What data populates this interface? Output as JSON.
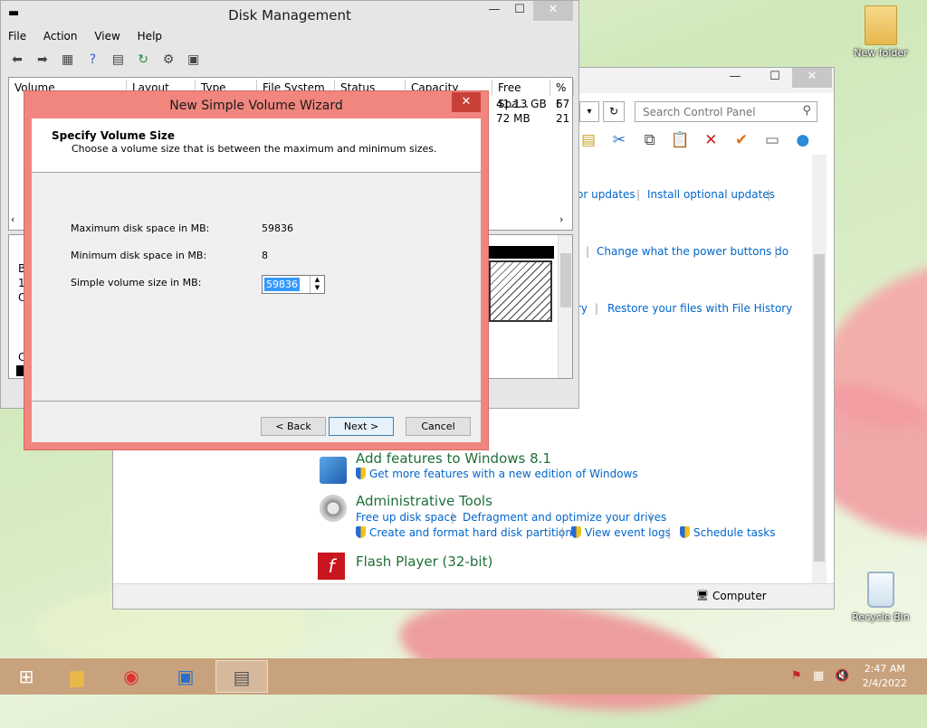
{
  "desktop": {
    "icons": [
      {
        "label": "New folder"
      },
      {
        "label": "Recycle Bin"
      }
    ]
  },
  "disk_management": {
    "title": "Disk Management",
    "menu": [
      "File",
      "Action",
      "View",
      "Help"
    ],
    "columns": [
      "Volume",
      "Layout",
      "Type",
      "File System",
      "Status",
      "Capacity",
      "Free Spa...",
      "% F"
    ],
    "rows": [
      {
        "free": "41.13 GB",
        "pct": "67"
      },
      {
        "free": "72 MB",
        "pct": "21"
      }
    ],
    "lower_labels": [
      "B",
      "1.",
      "O",
      "C"
    ]
  },
  "control_panel": {
    "search_placeholder": "Search Control Panel",
    "links": {
      "updates": "or updates",
      "optional_updates": "Install optional updates",
      "power_buttons": "Change what the power buttons do",
      "history_partial": "ry",
      "restore_files": "Restore your files with File History",
      "get_more_features": "Get more features with a new edition of Windows",
      "free_disk": "Free up disk space",
      "defrag": "Defragment and optimize your drives",
      "create_partitions": "Create and format hard disk partitions",
      "event_logs": "View event logs",
      "schedule_tasks": "Schedule tasks"
    },
    "headings": {
      "add_features": "Add features to Windows 8.1",
      "admin_tools": "Administrative Tools",
      "flash": "Flash Player (32-bit)"
    },
    "status": "Computer"
  },
  "wizard": {
    "title": "New Simple Volume Wizard",
    "close": "✕",
    "heading": "Specify Volume Size",
    "subheading": "Choose a volume size that is between the maximum and minimum sizes.",
    "max_label": "Maximum disk space in MB:",
    "max_value": "59836",
    "min_label": "Minimum disk space in MB:",
    "min_value": "8",
    "size_label": "Simple volume size in MB:",
    "size_value": "59836",
    "buttons": {
      "back": "< Back",
      "next": "Next >",
      "cancel": "Cancel"
    }
  },
  "taskbar": {
    "time": "2:47 AM",
    "date": "2/4/2022"
  }
}
